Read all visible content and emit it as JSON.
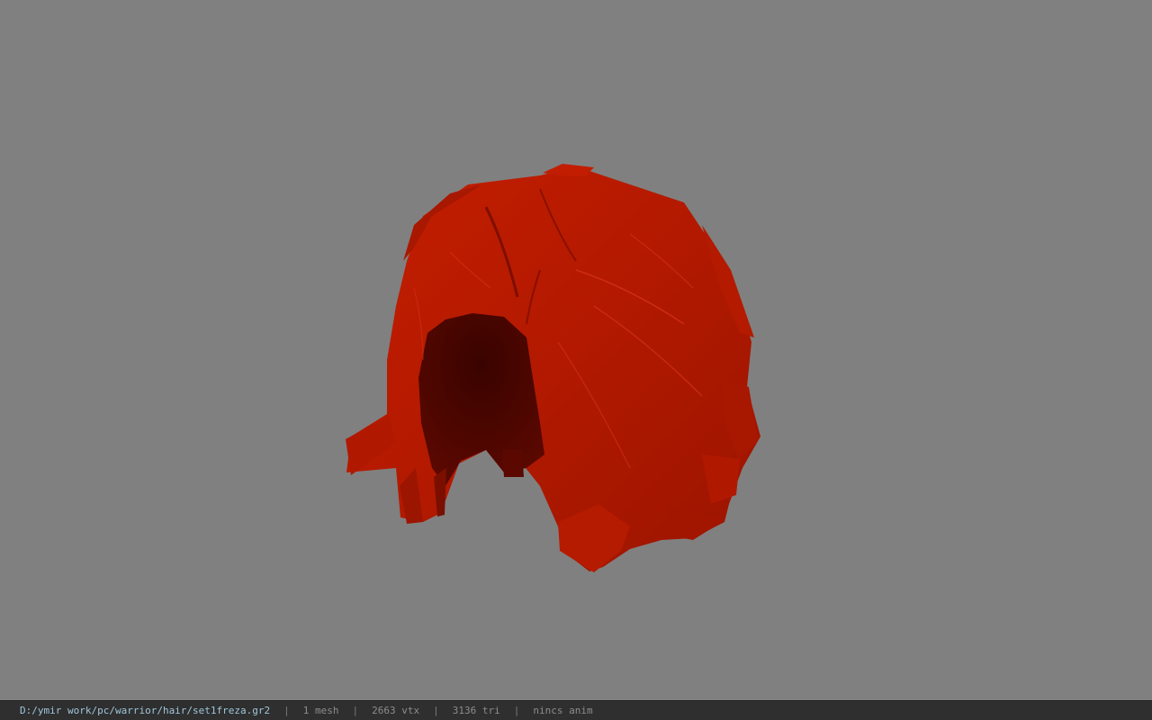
{
  "viewer": {
    "background_color": "#808080",
    "model_color": "#b81a00",
    "model_shadow_color": "#3d0400"
  },
  "status": {
    "file_path": "D:/ymir work/pc/warrior/hair/set1freza.gr2",
    "sep": "|",
    "mesh_count": "1 mesh",
    "vertex_count": "2663 vtx",
    "tri_count": "3136 tri",
    "anim": "nincs anim"
  }
}
